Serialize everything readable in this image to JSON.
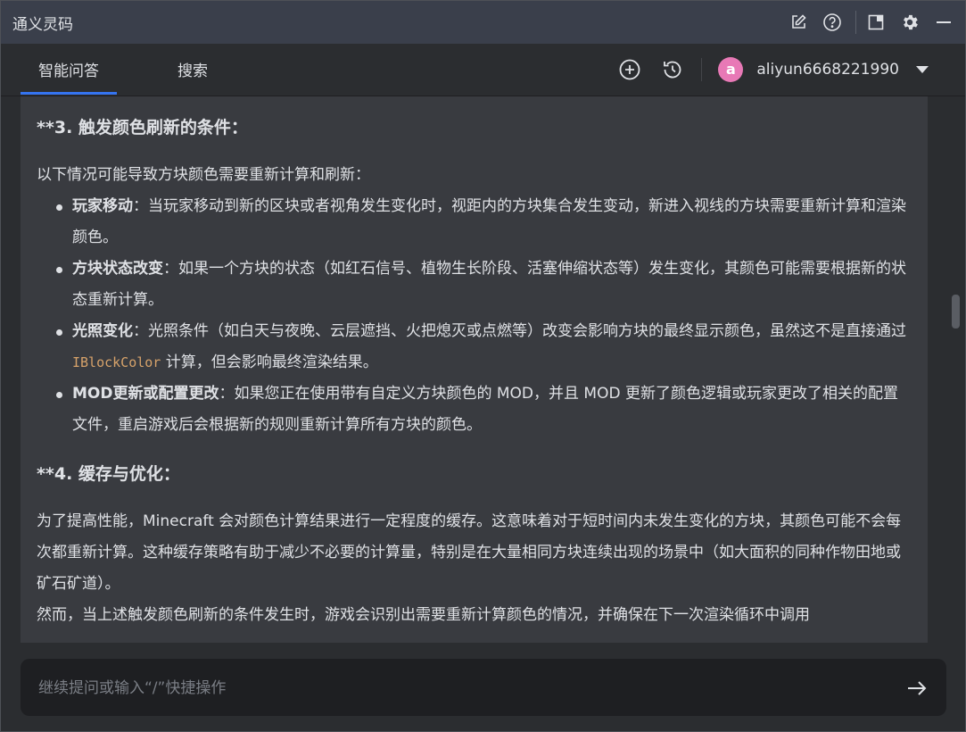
{
  "window": {
    "title": "通义灵码"
  },
  "titlebar_icons": [
    "edit-icon",
    "help-icon",
    "layout-icon",
    "gear-icon",
    "minimize-icon"
  ],
  "tabs": [
    {
      "label": "智能问答",
      "active": true
    },
    {
      "label": "搜索",
      "active": false
    }
  ],
  "user": {
    "avatar_letter": "a",
    "name": "aliyun6668221990",
    "avatar_color": "#e879b6"
  },
  "accent_color": "#3574f0",
  "content": {
    "section3_heading": "**3. 触发颜色刷新的条件：",
    "section3_intro": "以下情况可能导致方块颜色需要重新计算和刷新：",
    "bullets": [
      {
        "bold": "玩家移动",
        "text": "：当玩家移动到新的区块或者视角发生变化时，视距内的方块集合发生变动，新进入视线的方块需要重新计算和渲染颜色。"
      },
      {
        "bold": "方块状态改变",
        "text": "：如果一个方块的状态（如红石信号、植物生长阶段、活塞伸缩状态等）发生变化，其颜色可能需要根据新的状态重新计算。"
      },
      {
        "bold": "光照变化",
        "text_before": "：光照条件（如白天与夜晚、云层遮挡、火把熄灭或点燃等）改变会影响方块的最终显示颜色，虽然这不是直接通过 ",
        "code": "IBlockColor",
        "text_after": " 计算，但会影响最终渲染结果。"
      },
      {
        "bold": "MOD更新或配置更改",
        "text": "：如果您正在使用带有自定义方块颜色的 MOD，并且 MOD 更新了颜色逻辑或玩家更改了相关的配置文件，重启游戏后会根据新的规则重新计算所有方块的颜色。"
      }
    ],
    "section4_heading": "**4. 缓存与优化：",
    "section4_para1": "为了提高性能，Minecraft 会对颜色计算结果进行一定程度的缓存。这意味着对于短时间内未发生变化的方块，其颜色可能不会每次都重新计算。这种缓存策略有助于减少不必要的计算量，特别是在大量相同方块连续出现的场景中（如大面积的同种作物田地或矿石矿道）。",
    "section4_para2": "然而，当上述触发颜色刷新的条件发生时，游戏会识别出需要重新计算颜色的情况，并确保在下一次渲染循环中调用"
  },
  "input": {
    "placeholder": "继续提问或输入“/”快捷操作",
    "value": ""
  }
}
